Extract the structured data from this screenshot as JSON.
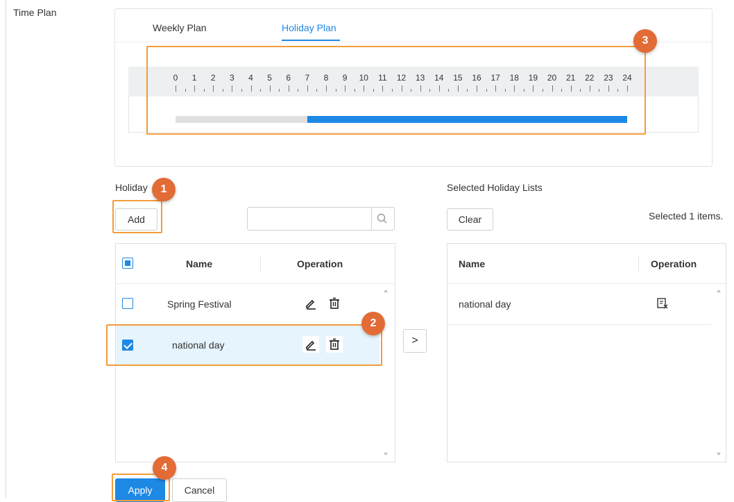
{
  "time_plan_label": "Time Plan",
  "tabs": [
    {
      "label": "Weekly Plan",
      "active": false
    },
    {
      "label": "Holiday Plan",
      "active": true
    }
  ],
  "timeline": {
    "hours": [
      "0",
      "1",
      "2",
      "3",
      "4",
      "5",
      "6",
      "7",
      "8",
      "9",
      "10",
      "11",
      "12",
      "13",
      "14",
      "15",
      "16",
      "17",
      "18",
      "19",
      "20",
      "21",
      "22",
      "23",
      "24"
    ],
    "plan_start_hour": 7,
    "plan_end_hour": 24
  },
  "holiday": {
    "title": "Holiday",
    "add_label": "Add",
    "search_placeholder": "",
    "columns": {
      "name": "Name",
      "operation": "Operation"
    },
    "rows": [
      {
        "name": "Spring Festival",
        "checked": false
      },
      {
        "name": "national day",
        "checked": true
      }
    ]
  },
  "selected": {
    "title": "Selected Holiday Lists",
    "clear_label": "Clear",
    "count_text": "Selected 1 items.",
    "columns": {
      "name": "Name",
      "operation": "Operation"
    },
    "rows": [
      {
        "name": "national day"
      }
    ]
  },
  "move_label": ">",
  "footer": {
    "apply_label": "Apply",
    "cancel_label": "Cancel"
  },
  "badges": [
    "1",
    "2",
    "3",
    "4"
  ],
  "colors": {
    "accent": "#1e88e5",
    "highlight": "#f39c3a",
    "badge": "#e26b36",
    "selected_row": "#e6f4fd"
  }
}
